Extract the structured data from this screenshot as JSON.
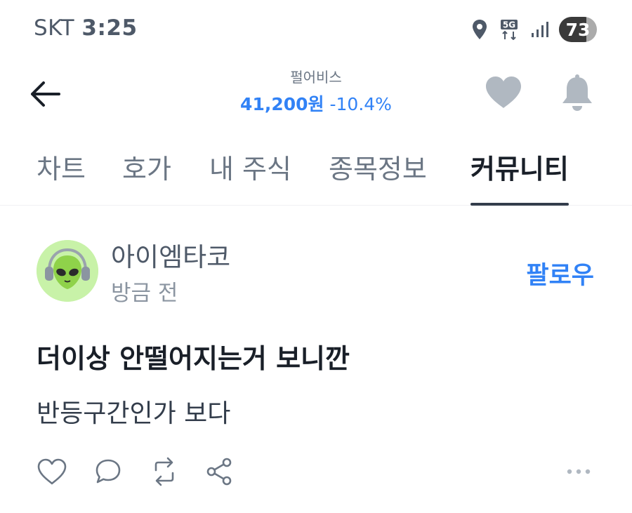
{
  "status_bar": {
    "carrier": "SKT",
    "time": "3:25",
    "network": "5G",
    "battery": 73,
    "icons": [
      "location-icon",
      "5g-data-icon",
      "signal-icon",
      "battery-icon"
    ]
  },
  "header": {
    "stock_name": "펄어비스",
    "price": "41,200원",
    "change": "-10.4%",
    "icons": [
      "back-arrow-icon",
      "heart-icon",
      "bell-icon"
    ]
  },
  "tabs": [
    {
      "label": "차트",
      "active": false
    },
    {
      "label": "호가",
      "active": false
    },
    {
      "label": "내 주식",
      "active": false
    },
    {
      "label": "종목정보",
      "active": false
    },
    {
      "label": "커뮤니티",
      "active": true
    }
  ],
  "post": {
    "author": "아이엠타코",
    "time": "방금 전",
    "follow_label": "팔로우",
    "title": "더이상 안떨어지는거 보니깐",
    "body": "반등구간인가 보다",
    "avatar_icon": "alien-avatar-icon",
    "action_icons": [
      "like-icon",
      "comment-icon",
      "repost-icon",
      "share-icon",
      "more-icon"
    ]
  },
  "colors": {
    "accent": "#3182f6",
    "text_primary": "#191f28",
    "text_secondary": "#6b7684",
    "icon_gray": "#b0b8c1",
    "avatar_bg": "#c8f2a8"
  }
}
